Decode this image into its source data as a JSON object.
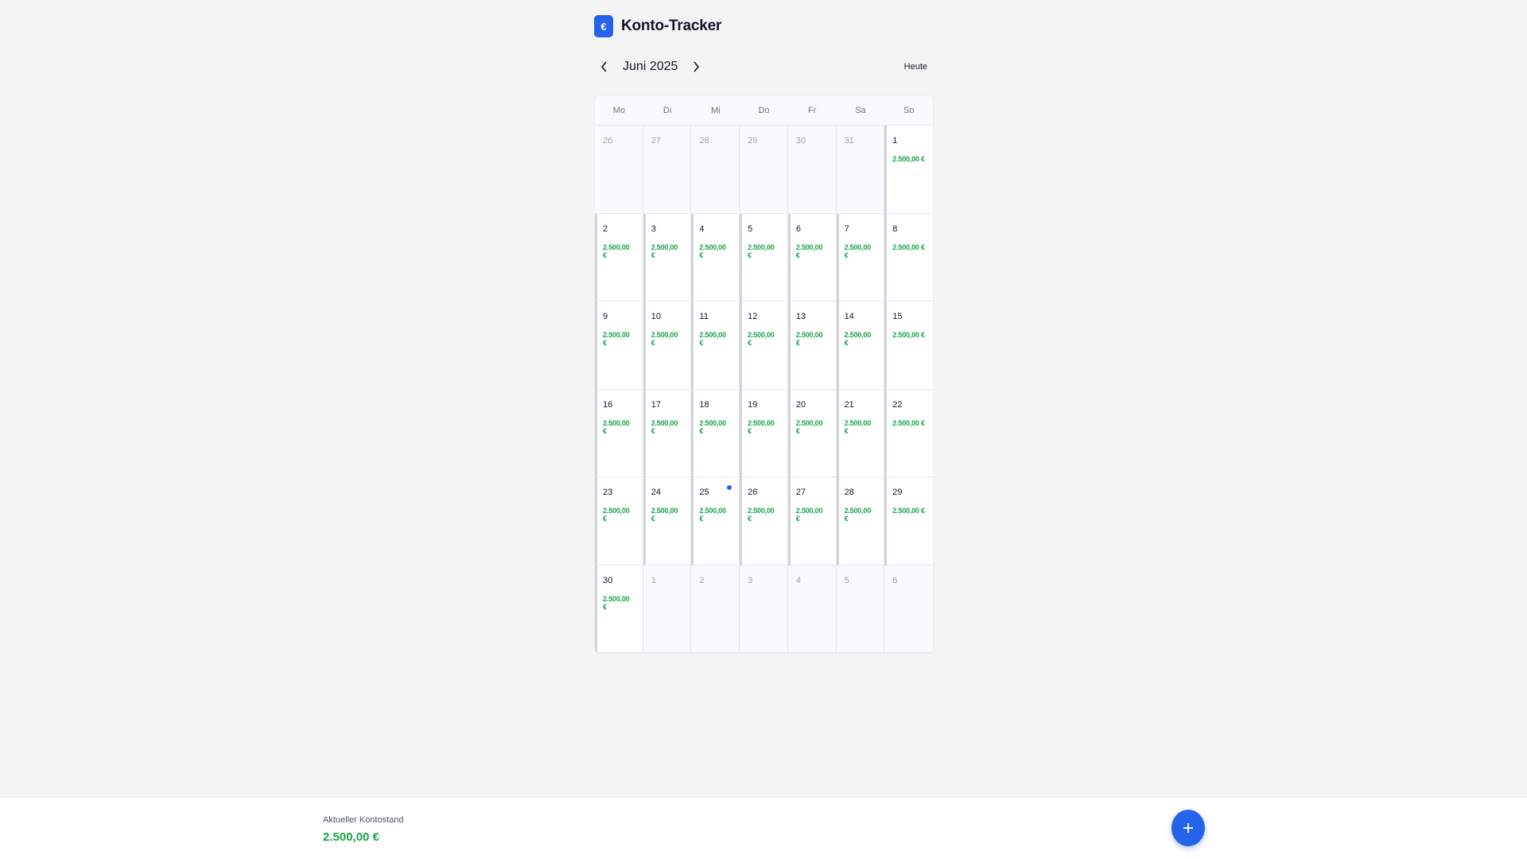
{
  "app": {
    "logo_glyph": "€",
    "title": "Konto-Tracker"
  },
  "nav": {
    "month_label": "Juni 2025",
    "today_label": "Heute",
    "prev_icon": "chevron-left-icon",
    "next_icon": "chevron-right-icon"
  },
  "calendar": {
    "weekdays": [
      "Mo",
      "Di",
      "Mi",
      "Do",
      "Fr",
      "Sa",
      "So"
    ],
    "days": [
      {
        "day": "26",
        "in_month": false,
        "amount": ""
      },
      {
        "day": "27",
        "in_month": false,
        "amount": ""
      },
      {
        "day": "28",
        "in_month": false,
        "amount": ""
      },
      {
        "day": "29",
        "in_month": false,
        "amount": ""
      },
      {
        "day": "30",
        "in_month": false,
        "amount": ""
      },
      {
        "day": "31",
        "in_month": false,
        "amount": ""
      },
      {
        "day": "1",
        "in_month": true,
        "amount": "2.500,00 €"
      },
      {
        "day": "2",
        "in_month": true,
        "amount": "2.500,00 €"
      },
      {
        "day": "3",
        "in_month": true,
        "amount": "2.500,00 €"
      },
      {
        "day": "4",
        "in_month": true,
        "amount": "2.500,00 €"
      },
      {
        "day": "5",
        "in_month": true,
        "amount": "2.500,00 €"
      },
      {
        "day": "6",
        "in_month": true,
        "amount": "2.500,00 €"
      },
      {
        "day": "7",
        "in_month": true,
        "amount": "2.500,00 €"
      },
      {
        "day": "8",
        "in_month": true,
        "amount": "2.500,00 €"
      },
      {
        "day": "9",
        "in_month": true,
        "amount": "2.500,00 €"
      },
      {
        "day": "10",
        "in_month": true,
        "amount": "2.500,00 €"
      },
      {
        "day": "11",
        "in_month": true,
        "amount": "2.500,00 €"
      },
      {
        "day": "12",
        "in_month": true,
        "amount": "2.500,00 €"
      },
      {
        "day": "13",
        "in_month": true,
        "amount": "2.500,00 €"
      },
      {
        "day": "14",
        "in_month": true,
        "amount": "2.500,00 €"
      },
      {
        "day": "15",
        "in_month": true,
        "amount": "2.500,00 €"
      },
      {
        "day": "16",
        "in_month": true,
        "amount": "2.500,00 €"
      },
      {
        "day": "17",
        "in_month": true,
        "amount": "2.500,00 €"
      },
      {
        "day": "18",
        "in_month": true,
        "amount": "2.500,00 €"
      },
      {
        "day": "19",
        "in_month": true,
        "amount": "2.500,00 €"
      },
      {
        "day": "20",
        "in_month": true,
        "amount": "2.500,00 €"
      },
      {
        "day": "21",
        "in_month": true,
        "amount": "2.500,00 €"
      },
      {
        "day": "22",
        "in_month": true,
        "amount": "2.500,00 €"
      },
      {
        "day": "23",
        "in_month": true,
        "amount": "2.500,00 €"
      },
      {
        "day": "24",
        "in_month": true,
        "amount": "2.500,00 €"
      },
      {
        "day": "25",
        "in_month": true,
        "amount": "2.500,00 €",
        "today": true
      },
      {
        "day": "26",
        "in_month": true,
        "amount": "2.500,00 €"
      },
      {
        "day": "27",
        "in_month": true,
        "amount": "2.500,00 €"
      },
      {
        "day": "28",
        "in_month": true,
        "amount": "2.500,00 €"
      },
      {
        "day": "29",
        "in_month": true,
        "amount": "2.500,00 €"
      },
      {
        "day": "30",
        "in_month": true,
        "amount": "2.500,00 €"
      },
      {
        "day": "1",
        "in_month": false,
        "amount": ""
      },
      {
        "day": "2",
        "in_month": false,
        "amount": ""
      },
      {
        "day": "3",
        "in_month": false,
        "amount": ""
      },
      {
        "day": "4",
        "in_month": false,
        "amount": ""
      },
      {
        "day": "5",
        "in_month": false,
        "amount": ""
      },
      {
        "day": "6",
        "in_month": false,
        "amount": ""
      }
    ]
  },
  "footer": {
    "balance_label": "Aktueller Kontostand",
    "balance_value": "2.500,00 €",
    "add_icon": "plus-icon"
  },
  "colors": {
    "accent": "#2563eb",
    "positive": "#16a34a",
    "background": "#f4f4f5"
  }
}
